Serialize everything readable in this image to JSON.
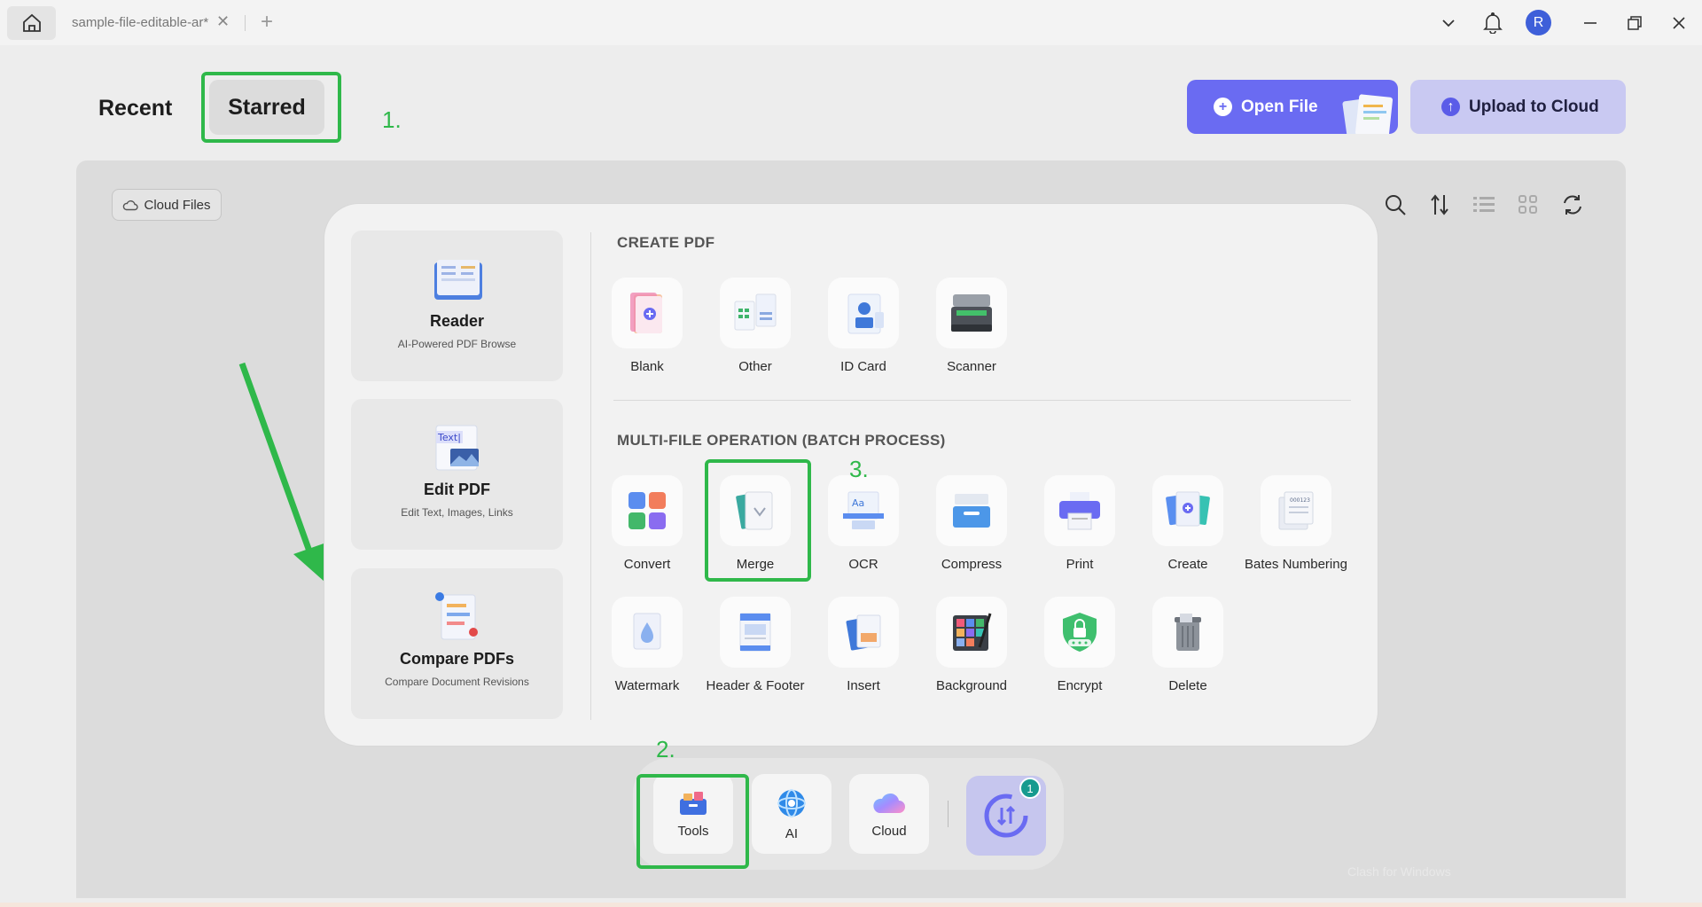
{
  "titlebar": {
    "tab_title": "sample-file-editable-ar*",
    "tab_close": "✕",
    "tab_add": "+",
    "avatar_initial": "R"
  },
  "header": {
    "tabs": [
      {
        "label": "Recent",
        "active": false
      },
      {
        "label": "Starred",
        "active": true
      }
    ],
    "open_file_label": "Open File",
    "upload_label": "Upload to Cloud"
  },
  "annotations": {
    "step1": "1.",
    "step2": "2.",
    "step3": "3.",
    "highlight_color": "#2fb84a"
  },
  "content": {
    "cloud_files_label": "Cloud Files",
    "toolbar_icons": [
      "search-icon",
      "sort-icon",
      "list-view-icon",
      "grid-view-icon",
      "refresh-icon"
    ]
  },
  "popup": {
    "feature_cards": [
      {
        "title": "Reader",
        "subtitle": "AI-Powered PDF Browse",
        "icon": "reader-icon"
      },
      {
        "title": "Edit PDF",
        "subtitle": "Edit Text, Images, Links",
        "icon": "edit-pdf-icon"
      },
      {
        "title": "Compare PDFs",
        "subtitle": "Compare Document Revisions",
        "icon": "compare-icon"
      }
    ],
    "create_title": "CREATE PDF",
    "create_tools": [
      {
        "label": "Blank",
        "icon": "blank-icon"
      },
      {
        "label": "Other",
        "icon": "other-icon"
      },
      {
        "label": "ID Card",
        "icon": "id-card-icon"
      },
      {
        "label": "Scanner",
        "icon": "scanner-icon"
      }
    ],
    "batch_title": "MULTI-FILE OPERATION (BATCH PROCESS)",
    "batch_tools_row1": [
      {
        "label": "Convert",
        "icon": "convert-icon"
      },
      {
        "label": "Merge",
        "icon": "merge-icon"
      },
      {
        "label": "OCR",
        "icon": "ocr-icon"
      },
      {
        "label": "Compress",
        "icon": "compress-icon"
      },
      {
        "label": "Print",
        "icon": "print-icon"
      },
      {
        "label": "Create",
        "icon": "create-icon"
      },
      {
        "label": "Bates Numbering",
        "icon": "bates-icon"
      }
    ],
    "batch_tools_row2": [
      {
        "label": "Watermark",
        "icon": "watermark-icon"
      },
      {
        "label": "Header & Footer",
        "icon": "header-footer-icon"
      },
      {
        "label": "Insert",
        "icon": "insert-icon"
      },
      {
        "label": "Background",
        "icon": "background-icon"
      },
      {
        "label": "Encrypt",
        "icon": "encrypt-icon"
      },
      {
        "label": "Delete",
        "icon": "delete-icon"
      }
    ]
  },
  "dock": {
    "items": [
      {
        "label": "Tools",
        "icon": "tools-icon"
      },
      {
        "label": "AI",
        "icon": "ai-icon"
      },
      {
        "label": "Cloud",
        "icon": "cloud-icon"
      }
    ],
    "sync_badge": "1"
  },
  "watermark_text": "Clash for Windows"
}
